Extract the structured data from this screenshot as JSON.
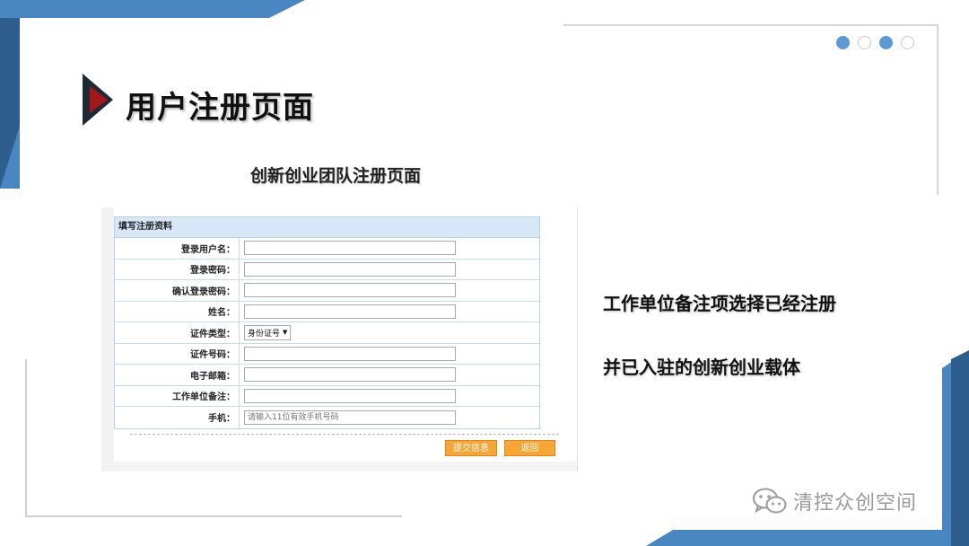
{
  "slide": {
    "title": "用户注册页面",
    "caption": "创新创业团队注册页面",
    "side_text_1": "工作单位备注项选择已经注册",
    "side_text_2": "并已入驻的创新创业载体",
    "watermark": "清控众创空间",
    "pagination_dots": [
      "filled",
      "empty",
      "filled",
      "empty"
    ],
    "colors": {
      "accent_blue": "#5b9bd5",
      "dark_blue": "#2e5e8e",
      "arrow_red": "#a5161b"
    }
  },
  "form": {
    "header": "填写注册资料",
    "fields": {
      "username_label": "登录用户名：",
      "password_label": "登录密码：",
      "confirm_password_label": "确认登录密码：",
      "name_label": "姓名：",
      "id_type_label": "证件类型：",
      "id_type_value": "身份证号",
      "id_number_label": "证件号码：",
      "email_label": "电子邮箱：",
      "workplace_label": "工作单位备注：",
      "phone_label": "手机：",
      "phone_placeholder": "请输入11位有效手机号码"
    },
    "buttons": {
      "submit": "提交信息",
      "back": "返回"
    }
  }
}
